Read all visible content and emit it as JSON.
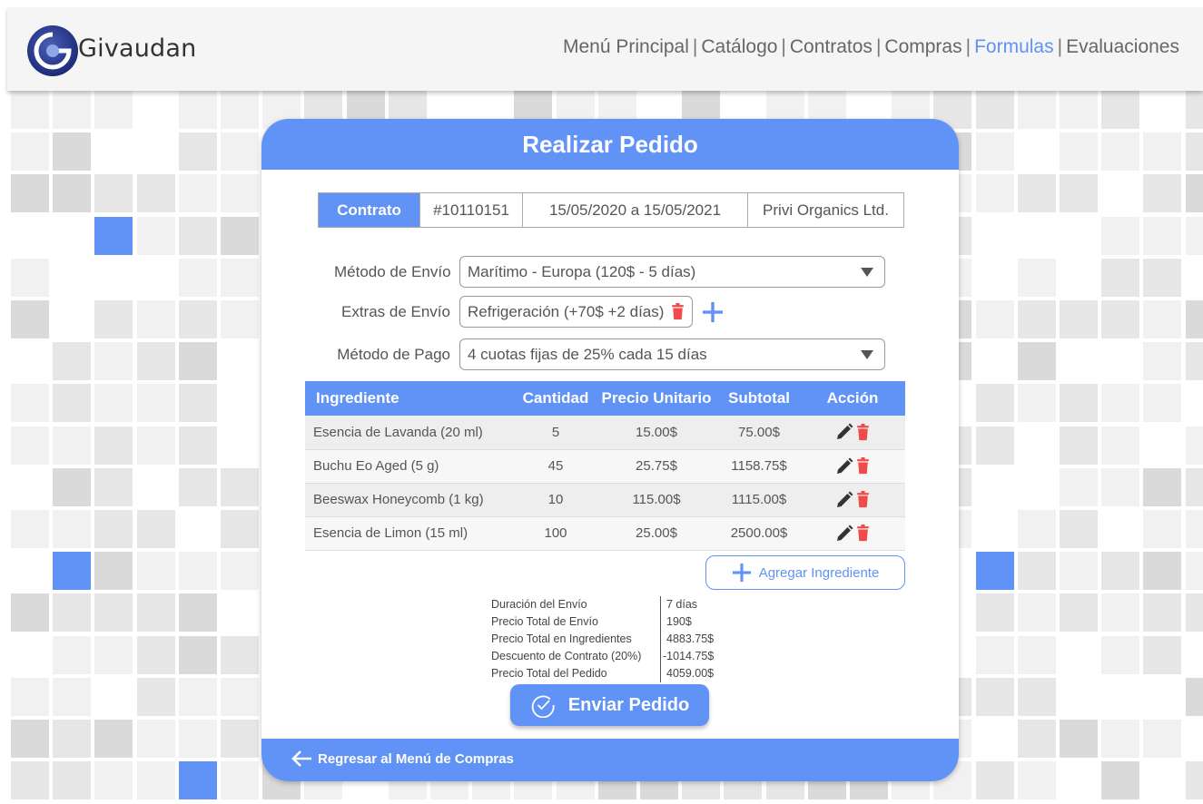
{
  "brand": {
    "name": "Givaudan"
  },
  "nav": {
    "items": [
      {
        "label": "Menú Principal",
        "active": false
      },
      {
        "label": "Catálogo",
        "active": false
      },
      {
        "label": "Contratos",
        "active": false
      },
      {
        "label": "Compras",
        "active": false
      },
      {
        "label": "Formulas",
        "active": true
      },
      {
        "label": "Evaluaciones",
        "active": false
      }
    ],
    "separator": "|"
  },
  "modal": {
    "title": "Realizar Pedido",
    "contract": {
      "label": "Contrato",
      "number": "#10110151",
      "dates": "15/05/2020 a 15/05/2021",
      "supplier": "Privi Organics Ltd."
    },
    "form": {
      "shipping_method": {
        "label": "Método de Envío",
        "value": "Marítimo - Europa (120$ - 5 días)"
      },
      "shipping_extras": {
        "label": "Extras de Envío",
        "value": "Refrigeración (+70$  +2 días)"
      },
      "payment_method": {
        "label": "Método de Pago",
        "value": "4 cuotas fijas de 25% cada 15 días"
      }
    },
    "table": {
      "headers": [
        "Ingrediente",
        "Cantidad",
        "Precio Unitario",
        "Subtotal",
        "Acción"
      ],
      "rows": [
        [
          "Esencia de Lavanda (20 ml)",
          "5",
          "15.00$",
          "75.00$"
        ],
        [
          "Buchu Eo Aged (5 g)",
          "45",
          "25.75$",
          "1158.75$"
        ],
        [
          "Beeswax Honeycomb (1 kg)",
          "10",
          "115.00$",
          "1115.00$"
        ],
        [
          "Esencia de Limon (15 ml)",
          "100",
          "25.00$",
          "2500.00$"
        ]
      ]
    },
    "add_ingredient_label": "Agregar Ingrediente",
    "summary": [
      {
        "label": "Duración del Envío",
        "value": "7 días"
      },
      {
        "label": "Precio Total de Envío",
        "value": "190$"
      },
      {
        "label": "Precio Total en Ingredientes",
        "value": "4883.75$"
      },
      {
        "label": "Descuento de Contrato (20%)",
        "value": "-1014.75$"
      },
      {
        "label": "Precio Total del Pedido",
        "value": "4059.00$"
      }
    ],
    "send_label": "Enviar Pedido",
    "back_label": "Regresar al Menú de Compras"
  },
  "colors": {
    "accent": "#6192f5",
    "danger": "#f04a4a",
    "tile_light": "#f1f1f1",
    "tile_mid": "#e6e6e6",
    "tile_dark": "#dadada"
  }
}
